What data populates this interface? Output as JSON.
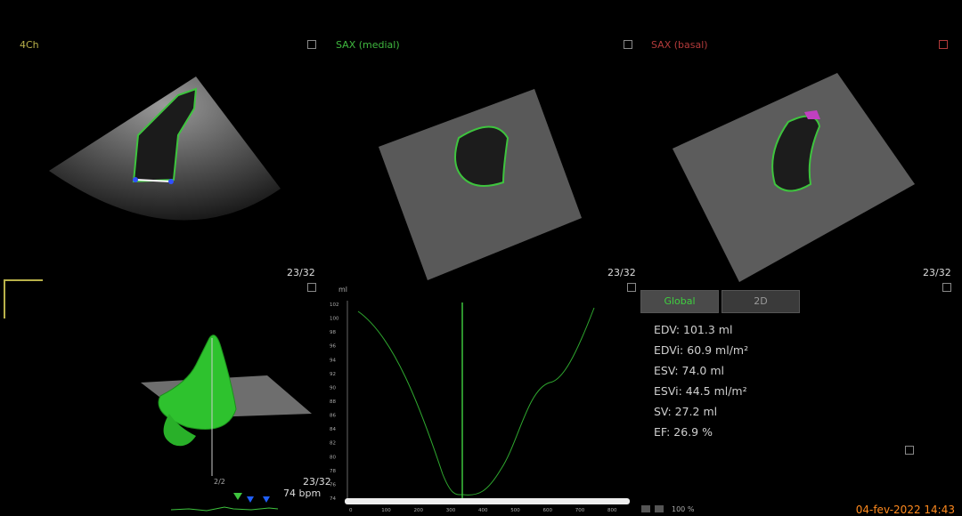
{
  "views": {
    "four_chamber": {
      "label": "4Ch",
      "frame": "23/32",
      "color": "#b9b14a"
    },
    "sax_medial": {
      "label": "SAX (medial)",
      "frame": "23/32",
      "color": "#3fb83f"
    },
    "sax_basal": {
      "label": "SAX (basal)",
      "frame": "23/32",
      "color": "#b23a3a"
    }
  },
  "model3d": {
    "frame": "23/32",
    "bpm": "74 bpm",
    "mini_frame": "2/2"
  },
  "volume_curve": {
    "y_unit": "ml",
    "y_ticks": [
      "102",
      "100",
      "98",
      "96",
      "94",
      "92",
      "90",
      "88",
      "86",
      "84",
      "82",
      "80",
      "78",
      "76",
      "74"
    ],
    "x_ticks": [
      "0",
      "100",
      "200",
      "300",
      "400",
      "500",
      "600",
      "700",
      "800"
    ]
  },
  "tabs": {
    "global": "Global",
    "2d": "2D"
  },
  "measurements": {
    "edv": "EDV: 101.3 ml",
    "edvi": "EDVi: 60.9 ml/m²",
    "esv": "ESV: 74.0 ml",
    "esvi": "ESVi: 44.5 ml/m²",
    "sv": "SV: 27.2 ml",
    "ef": "EF: 26.9 %"
  },
  "bottom": {
    "zoom": "100 %",
    "date": "04-fev-2022 14:43"
  },
  "colors": {
    "contour": "#3ec43e",
    "accent_orange": "#ff8a1e",
    "curve": "#2fa82f"
  }
}
